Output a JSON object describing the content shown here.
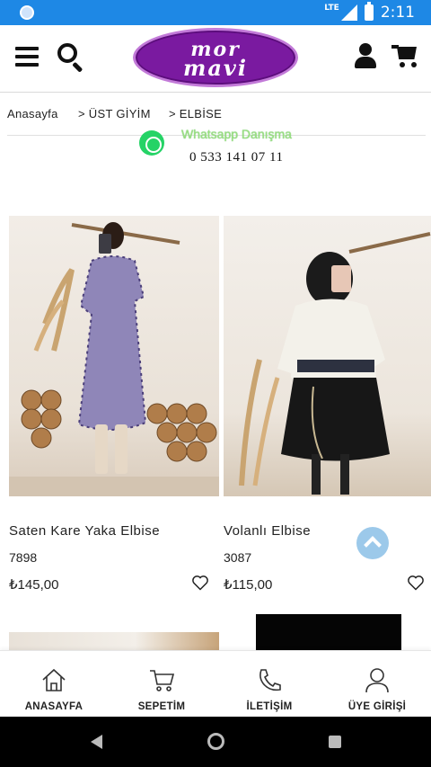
{
  "status_bar": {
    "time": "2:11",
    "network": "LTE"
  },
  "header": {
    "logo_line1": "mor",
    "logo_line2": "mavi"
  },
  "breadcrumb": [
    {
      "label": "Anasayfa"
    },
    {
      "label": "> ÜST GİYİM"
    },
    {
      "label": "> ELBİSE"
    }
  ],
  "whatsapp": {
    "title": "Whatsapp Danışma",
    "phone": "0 533 141 07 11"
  },
  "products": [
    {
      "name": "Saten Kare Yaka Elbise",
      "code": "7898",
      "price": "₺145,00"
    },
    {
      "name": "Volanlı Elbise",
      "code": "3087",
      "price": "₺115,00"
    }
  ],
  "bottom_nav": [
    {
      "label": "ANASAYFA",
      "icon": "home-icon"
    },
    {
      "label": "SEPETİM",
      "icon": "cart-icon"
    },
    {
      "label": "İLETİŞİM",
      "icon": "phone-icon"
    },
    {
      "label": "ÜYE GİRİŞİ",
      "icon": "user-icon"
    }
  ],
  "colors": {
    "status_bar": "#1e88e5",
    "brand_purple": "#7a1aa0",
    "whatsapp_green": "#25d366",
    "scroll_top": "#9cc9ea"
  }
}
